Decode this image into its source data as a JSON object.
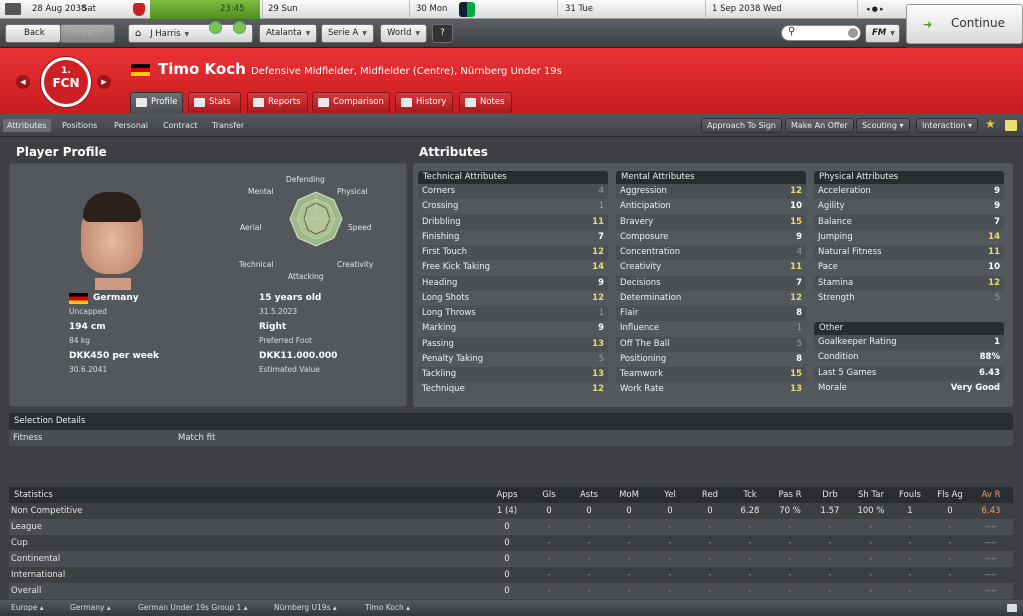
{
  "calendar": {
    "current_date": "28 Aug 2038",
    "current_day": "Sat",
    "time": "23:45",
    "days": [
      "29 Sun",
      "30 Mon",
      "31 Tue",
      "1 Sep 2038 Wed"
    ],
    "continue_label": "Continue"
  },
  "nav": {
    "back": "Back",
    "forward": "Forward",
    "manager": "J Harris",
    "team": "Atalanta",
    "league": "Serie A",
    "world": "World",
    "search_placeholder": ""
  },
  "player": {
    "name": "Timo Koch",
    "description": "Defensive Midfielder, Midfielder (Centre), Nürnberg Under 19s",
    "club_badge": "FCN",
    "club_badge_number": "1."
  },
  "tabs": [
    "Profile",
    "Stats",
    "Reports",
    "Comparison",
    "History",
    "Notes"
  ],
  "subnav": [
    "Attributes",
    "Positions",
    "Personal",
    "Contract",
    "Transfer"
  ],
  "actions": [
    "Approach To Sign",
    "Make An Offer",
    "Scouting",
    "Interaction"
  ],
  "profile": {
    "title": "Player Profile",
    "radar_labels": [
      "Defending",
      "Physical",
      "Speed",
      "Creativity",
      "Attacking",
      "Technical",
      "Aerial",
      "Mental"
    ],
    "nation": "Germany",
    "caps": "Uncapped",
    "age": "15 years old",
    "dob": "31.5.2023",
    "height": "194 cm",
    "weight": "84 kg",
    "foot": "Right",
    "foot_label": "Preferred Foot",
    "wage": "DKK450 per week",
    "contract_end": "30.6.2041",
    "value": "DKK11.000.000",
    "value_label": "Estimated Value"
  },
  "attributes": {
    "title": "Attributes",
    "technical": {
      "header": "Technical Attributes",
      "rows": [
        [
          "Corners",
          "4"
        ],
        [
          "Crossing",
          "1"
        ],
        [
          "Dribbling",
          "11"
        ],
        [
          "Finishing",
          "7"
        ],
        [
          "First Touch",
          "12"
        ],
        [
          "Free Kick Taking",
          "14"
        ],
        [
          "Heading",
          "9"
        ],
        [
          "Long Shots",
          "12"
        ],
        [
          "Long Throws",
          "1"
        ],
        [
          "Marking",
          "9"
        ],
        [
          "Passing",
          "13"
        ],
        [
          "Penalty Taking",
          "5"
        ],
        [
          "Tackling",
          "13"
        ],
        [
          "Technique",
          "12"
        ]
      ]
    },
    "mental": {
      "header": "Mental Attributes",
      "rows": [
        [
          "Aggression",
          "12"
        ],
        [
          "Anticipation",
          "10"
        ],
        [
          "Bravery",
          "15"
        ],
        [
          "Composure",
          "9"
        ],
        [
          "Concentration",
          "4"
        ],
        [
          "Creativity",
          "11"
        ],
        [
          "Decisions",
          "7"
        ],
        [
          "Determination",
          "12"
        ],
        [
          "Flair",
          "8"
        ],
        [
          "Influence",
          "1"
        ],
        [
          "Off The Ball",
          "5"
        ],
        [
          "Positioning",
          "8"
        ],
        [
          "Teamwork",
          "15"
        ],
        [
          "Work Rate",
          "13"
        ]
      ]
    },
    "physical": {
      "header": "Physical Attributes",
      "rows": [
        [
          "Acceleration",
          "9"
        ],
        [
          "Agility",
          "9"
        ],
        [
          "Balance",
          "7"
        ],
        [
          "Jumping",
          "14"
        ],
        [
          "Natural Fitness",
          "11"
        ],
        [
          "Pace",
          "10"
        ],
        [
          "Stamina",
          "12"
        ],
        [
          "Strength",
          "5"
        ]
      ]
    },
    "other": {
      "header": "Other",
      "rows": [
        [
          "Goalkeeper Rating",
          "1"
        ],
        [
          "Condition",
          "88%"
        ],
        [
          "Last 5 Games",
          "6.43"
        ],
        [
          "Morale",
          "Very Good"
        ]
      ]
    }
  },
  "selection": {
    "header": "Selection Details",
    "label": "Fitness",
    "value": "Match fit"
  },
  "statistics": {
    "header": "Statistics",
    "columns": [
      "Apps",
      "Gls",
      "Asts",
      "MoM",
      "Yel",
      "Red",
      "Tck",
      "Pas R",
      "Drb",
      "Sh Tar",
      "Fouls",
      "Fls Ag",
      "Av R"
    ],
    "rows": [
      {
        "label": "Non Competitive",
        "values": [
          "1 (4)",
          "0",
          "0",
          "0",
          "0",
          "0",
          "6.28",
          "70 %",
          "1.57",
          "100 %",
          "1",
          "0",
          "6.43"
        ]
      },
      {
        "label": "League",
        "values": [
          "0",
          "-",
          "-",
          "-",
          "-",
          "-",
          "-",
          "-",
          "-",
          "-",
          "-",
          "-",
          "----"
        ]
      },
      {
        "label": "Cup",
        "values": [
          "0",
          "-",
          "-",
          "-",
          "-",
          "-",
          "-",
          "-",
          "-",
          "-",
          "-",
          "-",
          "----"
        ]
      },
      {
        "label": "Continental",
        "values": [
          "0",
          "-",
          "-",
          "-",
          "-",
          "-",
          "-",
          "-",
          "-",
          "-",
          "-",
          "-",
          "----"
        ]
      },
      {
        "label": "International",
        "values": [
          "0",
          "-",
          "-",
          "-",
          "-",
          "-",
          "-",
          "-",
          "-",
          "-",
          "-",
          "-",
          "----"
        ]
      },
      {
        "label": "Overall",
        "values": [
          "0",
          "-",
          "-",
          "-",
          "-",
          "-",
          "-",
          "-",
          "-",
          "-",
          "-",
          "-",
          "----"
        ]
      }
    ]
  },
  "breadcrumb": [
    "Europe",
    "Germany",
    "German Under 19s Group 1",
    "Nürnberg U19s",
    "Timo Koch"
  ],
  "colors": {
    "header_red": "#d9262a",
    "accent_yellow": "#e6df66",
    "continue_green": "#4a9b2a"
  }
}
